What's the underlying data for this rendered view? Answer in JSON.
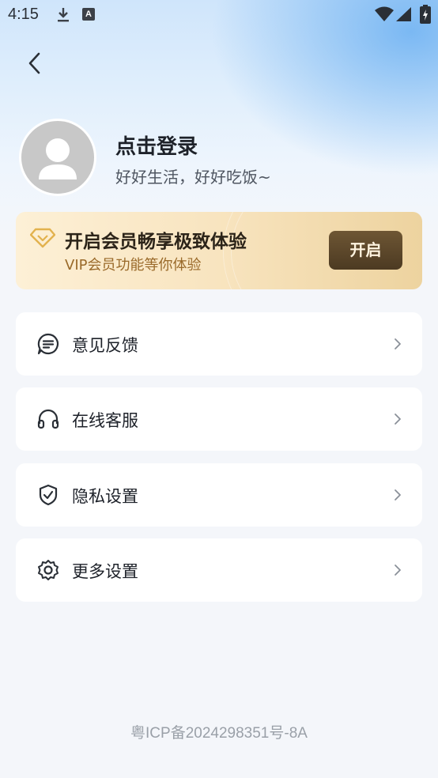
{
  "status_bar": {
    "time": "4:15",
    "icons": [
      "download-icon",
      "a-icon",
      "wifi-icon",
      "signal-icon",
      "battery-icon"
    ],
    "a_glyph": "A"
  },
  "header": {
    "back_icon": "chevron-left-icon"
  },
  "profile": {
    "title": "点击登录",
    "subtitle": "好好生活，好好吃饭~",
    "avatar_icon": "user-avatar-icon"
  },
  "vip": {
    "title": "开启会员畅享极致体验",
    "subtitle": "VIP会员功能等你体验",
    "button_label": "开启",
    "icon": "diamond-icon",
    "colors": {
      "gradient_start": "#fdf0d6",
      "gradient_end": "#edd39f",
      "button": "#5c4528",
      "subtitle": "#9a6a2a"
    }
  },
  "menu": {
    "items": [
      {
        "label": "意见反馈",
        "icon": "feedback-icon"
      },
      {
        "label": "在线客服",
        "icon": "headset-icon"
      },
      {
        "label": "隐私设置",
        "icon": "shield-check-icon"
      },
      {
        "label": "更多设置",
        "icon": "gear-icon"
      }
    ],
    "chevron_icon": "chevron-right-icon"
  },
  "footer": {
    "icp": "粤ICP备2024298351号-8A"
  }
}
